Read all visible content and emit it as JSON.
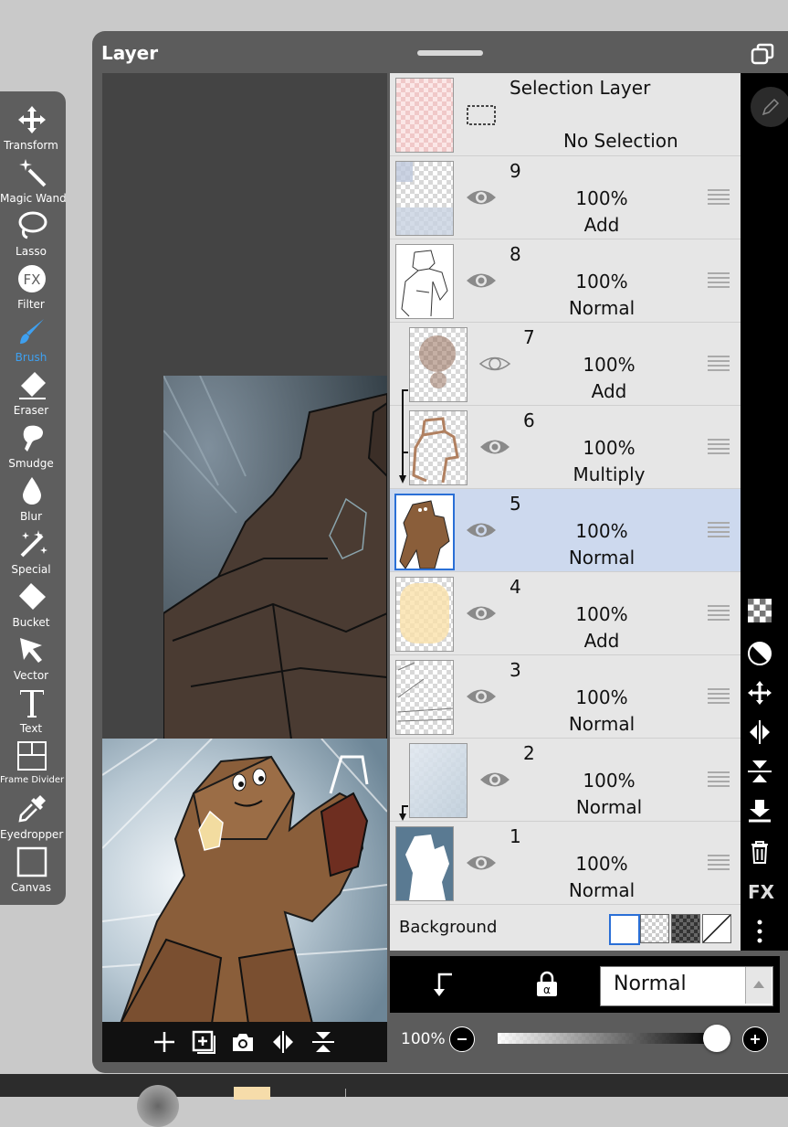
{
  "panel": {
    "title": "Layer"
  },
  "toolbar": {
    "tools": [
      {
        "label": "Transform",
        "icon": "move-arrows-icon"
      },
      {
        "label": "Magic Wand",
        "icon": "magic-wand-icon"
      },
      {
        "label": "Lasso",
        "icon": "lasso-icon"
      },
      {
        "label": "Filter",
        "icon": "fx-icon"
      },
      {
        "label": "Brush",
        "icon": "brush-icon",
        "active": true
      },
      {
        "label": "Eraser",
        "icon": "eraser-icon"
      },
      {
        "label": "Smudge",
        "icon": "smudge-icon"
      },
      {
        "label": "Blur",
        "icon": "drop-icon"
      },
      {
        "label": "Special",
        "icon": "sparkle-wand-icon"
      },
      {
        "label": "Bucket",
        "icon": "bucket-icon"
      },
      {
        "label": "Vector",
        "icon": "cursor-arrow-icon"
      },
      {
        "label": "Text",
        "icon": "text-t-icon"
      },
      {
        "label": "Frame Divider",
        "icon": "frame-divider-icon"
      },
      {
        "label": "Eyedropper",
        "icon": "eyedropper-icon"
      },
      {
        "label": "Canvas",
        "icon": "canvas-square-icon"
      }
    ],
    "active_color": "#3ea0f0"
  },
  "selection_layer": {
    "title": "Selection Layer",
    "status": "No Selection"
  },
  "layers": [
    {
      "num": "9",
      "opacity": "100%",
      "blend": "Add"
    },
    {
      "num": "8",
      "opacity": "100%",
      "blend": "Normal"
    },
    {
      "num": "7",
      "opacity": "100%",
      "blend": "Add"
    },
    {
      "num": "6",
      "opacity": "100%",
      "blend": "Multiply"
    },
    {
      "num": "5",
      "opacity": "100%",
      "blend": "Normal"
    },
    {
      "num": "4",
      "opacity": "100%",
      "blend": "Add"
    },
    {
      "num": "3",
      "opacity": "100%",
      "blend": "Normal"
    },
    {
      "num": "2",
      "opacity": "100%",
      "blend": "Normal"
    },
    {
      "num": "1",
      "opacity": "100%",
      "blend": "Normal"
    }
  ],
  "background": {
    "label": "Background"
  },
  "blend_mode": {
    "value": "Normal"
  },
  "opacity": {
    "label": "100%",
    "value": 1.0
  },
  "right_strip_icons": [
    "checker-icon",
    "half-circle-icon",
    "move-icon",
    "flip-horizontal-icon",
    "flip-vertical-icon",
    "merge-down-icon",
    "trash-icon",
    "fx-label",
    "more-vertical-icon"
  ],
  "right_strip_fx": "FX",
  "colors": {
    "selected_row": "#cdd9ee",
    "accent": "#3ea0f0"
  }
}
